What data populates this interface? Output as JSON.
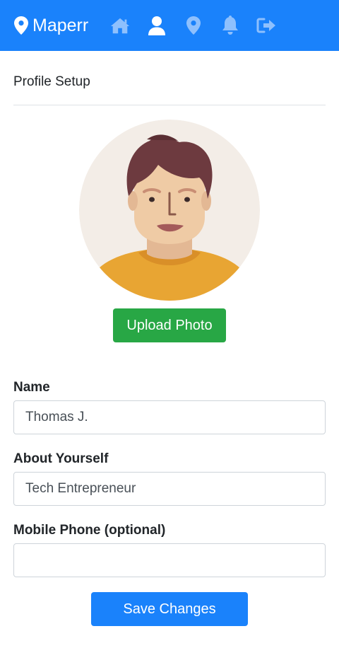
{
  "navbar": {
    "brand": "Maperr",
    "icons": [
      "home-icon",
      "user-icon",
      "map-marker-icon",
      "bell-icon",
      "sign-out-icon"
    ],
    "background": "#1a82fb",
    "icon_color": "#8ec0fd"
  },
  "page": {
    "title": "Profile Setup"
  },
  "profile": {
    "upload_label": "Upload Photo"
  },
  "form": {
    "name": {
      "label": "Name",
      "value": "Thomas J."
    },
    "about": {
      "label": "About Yourself",
      "value": "Tech Entrepreneur"
    },
    "phone": {
      "label": "Mobile Phone (optional)",
      "value": ""
    },
    "save_label": "Save Changes"
  },
  "colors": {
    "primary": "#1a82fb",
    "success": "#28a745",
    "avatar_bg": "#f3ede7"
  }
}
